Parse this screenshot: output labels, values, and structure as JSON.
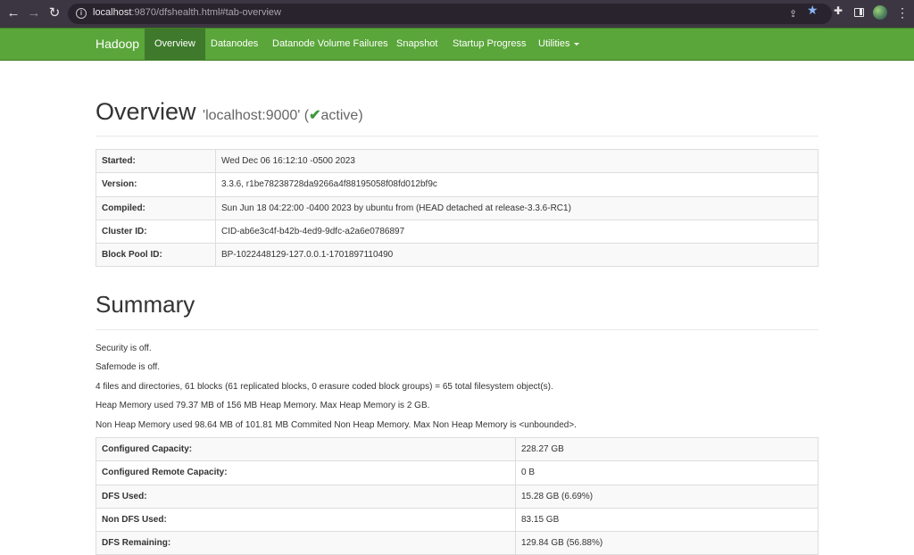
{
  "browser": {
    "url_host": "localhost",
    "url_rest": ":9870/dfshealth.html#tab-overview"
  },
  "navbar": {
    "brand": "Hadoop",
    "items": [
      {
        "label": "Overview",
        "active": true
      },
      {
        "label": "Datanodes"
      },
      {
        "label": "Datanode Volume Failures"
      },
      {
        "label": "Snapshot"
      },
      {
        "label": "Startup Progress"
      },
      {
        "label": "Utilities"
      }
    ]
  },
  "overview": {
    "title": "Overview",
    "host": "'localhost:9000'",
    "status_open": "(",
    "status_check": "✔",
    "status": "active)",
    "rows": [
      {
        "key": "Started:",
        "value": "Wed Dec 06 16:12:10 -0500 2023"
      },
      {
        "key": "Version:",
        "value": "3.3.6, r1be78238728da9266a4f88195058f08fd012bf9c"
      },
      {
        "key": "Compiled:",
        "value": "Sun Jun 18 04:22:00 -0400 2023 by ubuntu from (HEAD detached at release-3.3.6-RC1)"
      },
      {
        "key": "Cluster ID:",
        "value": "CID-ab6e3c4f-b42b-4ed9-9dfc-a2a6e0786897"
      },
      {
        "key": "Block Pool ID:",
        "value": "BP-1022448129-127.0.0.1-1701897110490"
      }
    ]
  },
  "summary": {
    "title": "Summary",
    "lines": [
      "Security is off.",
      "Safemode is off.",
      "4 files and directories, 61 blocks (61 replicated blocks, 0 erasure coded block groups) = 65 total filesystem object(s).",
      "Heap Memory used 79.37 MB of 156 MB Heap Memory. Max Heap Memory is 2 GB.",
      "Non Heap Memory used 98.64 MB of 101.81 MB Commited Non Heap Memory. Max Non Heap Memory is <unbounded>."
    ],
    "rows": [
      {
        "key": "Configured Capacity:",
        "value": "228.27 GB"
      },
      {
        "key": "Configured Remote Capacity:",
        "value": "0 B"
      },
      {
        "key": "DFS Used:",
        "value": "15.28 GB (6.69%)"
      },
      {
        "key": "Non DFS Used:",
        "value": "83.15 GB"
      },
      {
        "key": "DFS Remaining:",
        "value": "129.84 GB (56.88%)"
      }
    ]
  }
}
